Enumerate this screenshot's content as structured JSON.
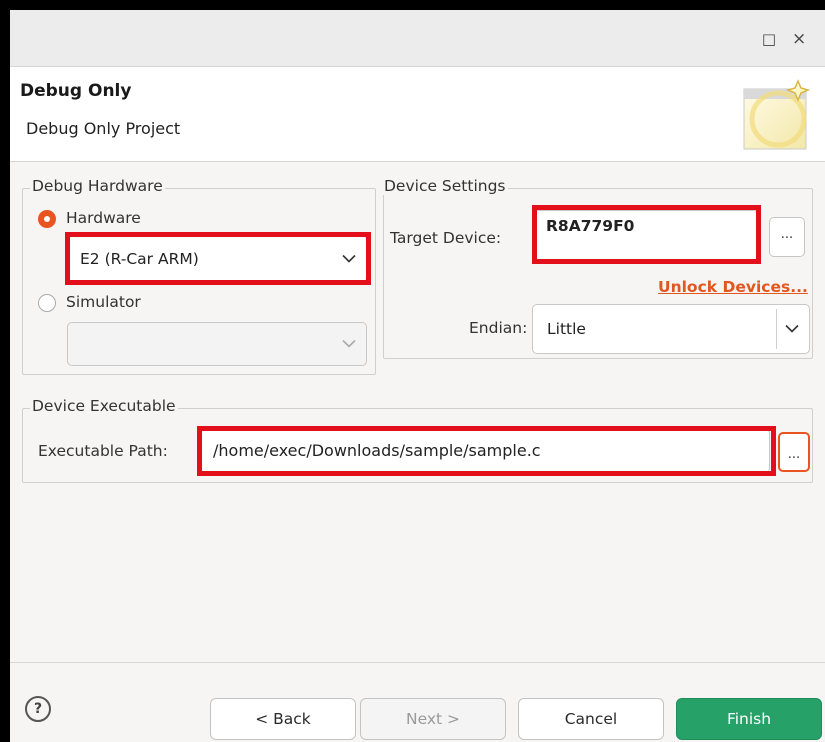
{
  "window": {
    "title": "",
    "maximize_icon": "□",
    "close_icon": "×"
  },
  "header": {
    "title": "Debug Only",
    "subtitle": "Debug Only Project"
  },
  "debug_hardware": {
    "group_label": "Debug Hardware",
    "hardware_option": "Hardware",
    "hardware_selected": true,
    "hardware_value": "E2 (R-Car ARM)",
    "simulator_option": "Simulator",
    "simulator_selected": false,
    "simulator_value": ""
  },
  "device_settings": {
    "group_label": "Device Settings",
    "target_label": "Target Device:",
    "target_value": "R8A779F0",
    "browse_label": "...",
    "unlock_link": "Unlock Devices...",
    "endian_label": "Endian:",
    "endian_value": "Little"
  },
  "device_executable": {
    "group_label": "Device Executable",
    "path_label": "Executable Path:",
    "path_value": "/home/exec/Downloads/sample/sample.c",
    "browse_label": "..."
  },
  "footer": {
    "help_icon": "?",
    "back_label": "< Back",
    "next_label": "Next >",
    "cancel_label": "Cancel",
    "finish_label": "Finish"
  },
  "colors": {
    "accent_red": "#e3101c",
    "radio_orange": "#e95420",
    "finish_green": "#26a269",
    "link_orange": "#e2561f"
  }
}
